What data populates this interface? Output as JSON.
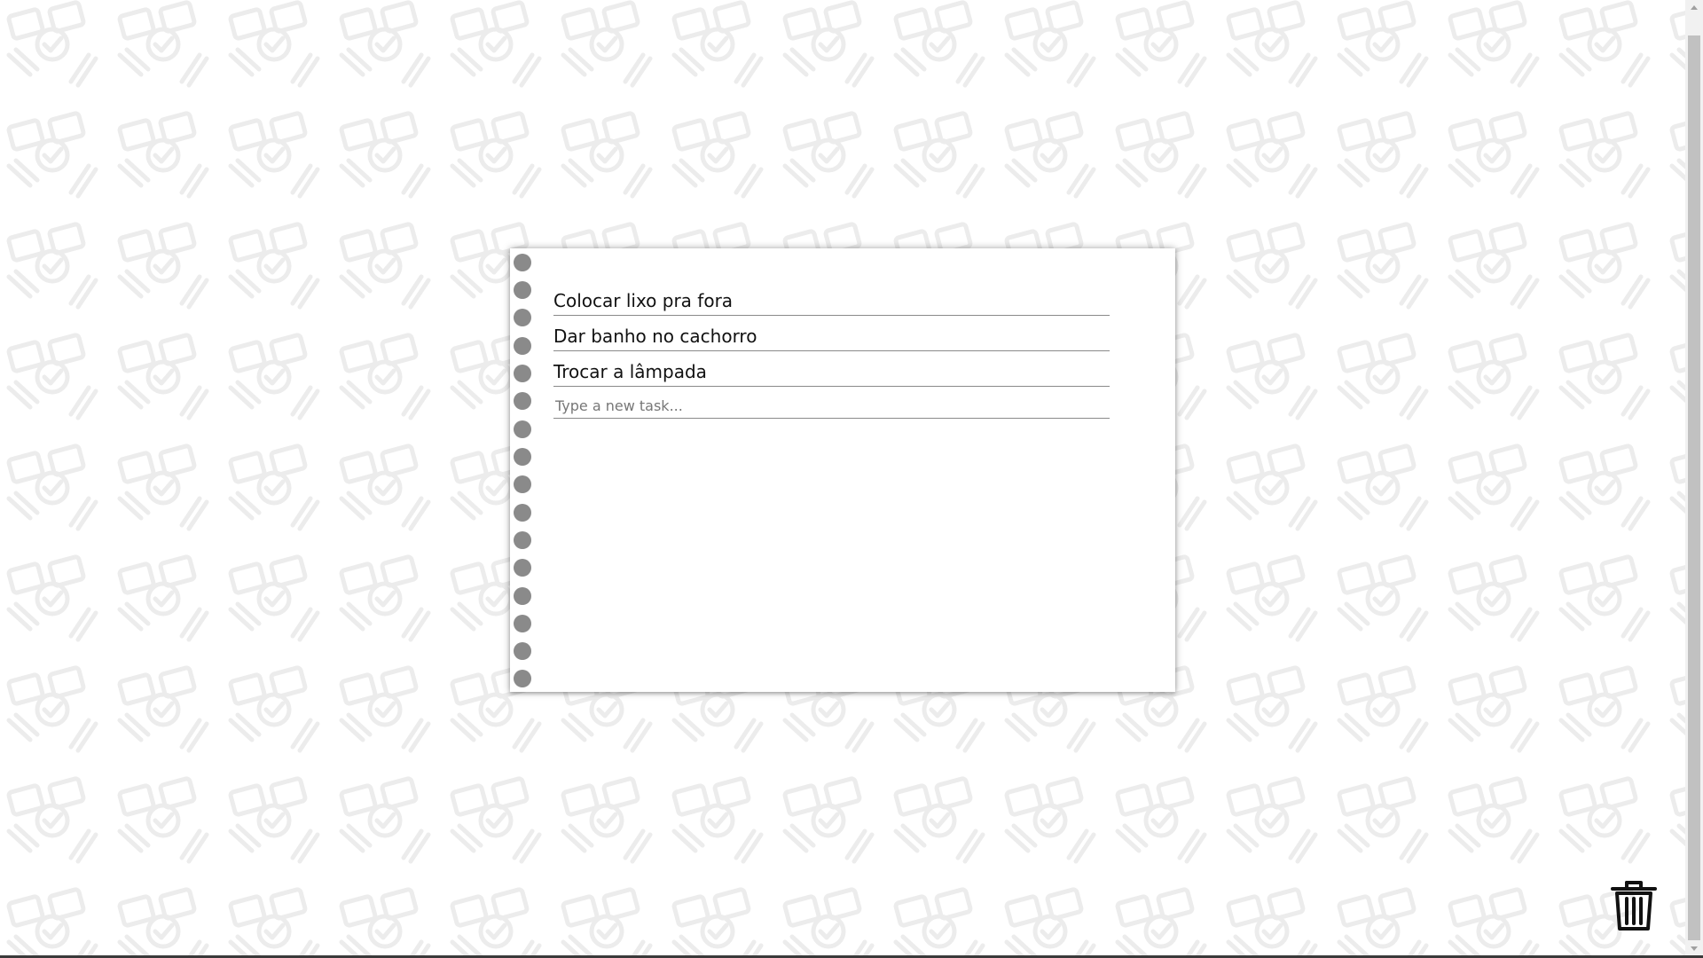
{
  "tasks": [
    {
      "text": "Colocar lixo pra fora"
    },
    {
      "text": "Dar banho no cachorro"
    },
    {
      "text": "Trocar a lâmpada"
    }
  ],
  "new_task": {
    "placeholder": "Type a new task...",
    "value": ""
  },
  "icons": {
    "trash": "trash-icon",
    "background": "clipboard-check-pencil-pattern"
  },
  "colors": {
    "background": "#ffffff",
    "pattern": "#f0f0f0",
    "hole": "#8a8a8a",
    "text": "#111111",
    "line": "#8a8a8a"
  }
}
